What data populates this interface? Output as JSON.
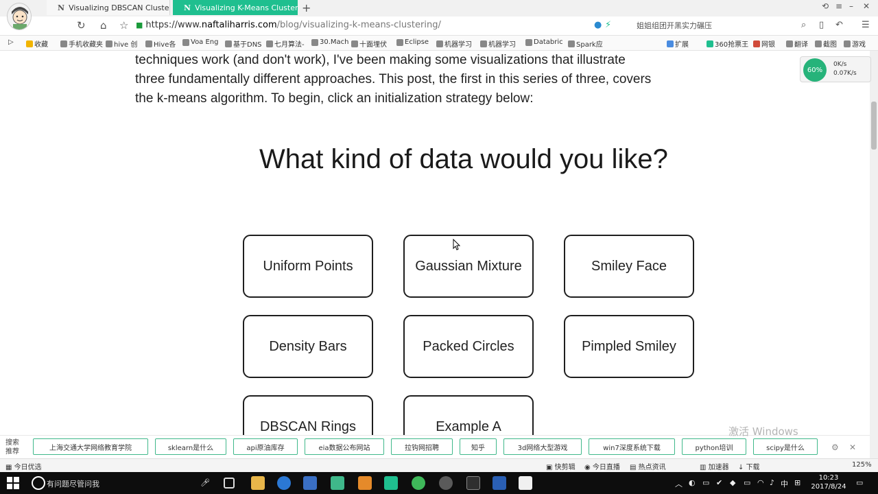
{
  "browser": {
    "tabs": [
      {
        "title": "Visualizing DBSCAN Clustering",
        "favicon": "N",
        "active": false
      },
      {
        "title": "Visualizing K-Means Clustering",
        "favicon": "N",
        "active": true
      }
    ],
    "url_prefix": "https://www.",
    "url_host": "naftaliharris.com",
    "url_path": "/blog/visualizing-k-means-clustering/",
    "search_placeholder": "姐姐组团开黑实力碾压",
    "bookmarks": [
      "收藏",
      "手机收藏夹",
      "hive 创",
      "Hive各",
      "Voa Eng",
      "基于DNS",
      "七月算法-",
      "30.Mach",
      "十面埋伏",
      "Eclipse",
      "机器学习",
      "机器学习",
      "Databric",
      "Spark应"
    ],
    "bookmarks_right": [
      "扩展",
      "360抢票王",
      "网银",
      "翻译",
      "截图",
      "游戏"
    ],
    "net_speed": {
      "label": "60%",
      "up": "0K/s",
      "down": "0.07K/s"
    }
  },
  "page": {
    "intro_lines": [
      "techniques work (and don't work), I've been making some visualizations that illustrate",
      "three fundamentally different approaches. This post, the first in this series of three, covers",
      "the k-means algorithm. To begin, click an initialization strategy below:"
    ],
    "question": "What kind of data would you like?",
    "options": [
      "Uniform Points",
      "Gaussian Mixture",
      "Smiley Face",
      "Density Bars",
      "Packed Circles",
      "Pimpled Smiley",
      "DBSCAN Rings",
      "Example A"
    ]
  },
  "suggestions": {
    "label": "搜索推荐",
    "items": [
      "上海交通大学网络教育学院",
      "sklearn是什么",
      "api原油库存",
      "eia数据公布网站",
      "拉钩网招聘",
      "知乎",
      "3d网络大型游戏",
      "win7深度系统下载",
      "python培训",
      "scipy是什么"
    ],
    "watermark": "激活 Windows"
  },
  "statusbar": {
    "left": "今日优选",
    "items": [
      "快剪辑",
      "今日直播",
      "热点资讯",
      "加速器",
      "下载",
      "125%"
    ]
  },
  "taskbar": {
    "search_text": "有问题尽管问我",
    "ime": "中",
    "time": "10:23",
    "date": "2017/8/24"
  },
  "colors": {
    "active_tab": "#1fbf8f",
    "chip_border": "#3fb88a",
    "option_border": "#1e1e1e"
  }
}
